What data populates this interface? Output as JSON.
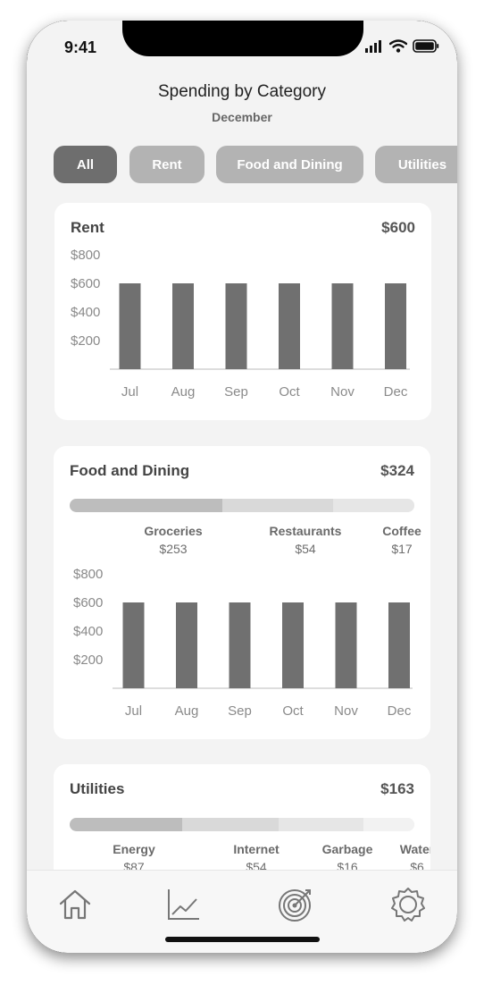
{
  "status": {
    "time": "9:41"
  },
  "header": {
    "title": "Spending by Category",
    "subtitle": "December"
  },
  "filters": [
    "All",
    "Rent",
    "Food and Dining",
    "Utilities"
  ],
  "cards": {
    "rent": {
      "title": "Rent",
      "amount": "$600"
    },
    "food": {
      "title": "Food and Dining",
      "amount": "$324",
      "breakdown": [
        {
          "name": "Groceries",
          "value": "$253"
        },
        {
          "name": "Restaurants",
          "value": "$54"
        },
        {
          "name": "Coffee",
          "value": "$17"
        }
      ]
    },
    "utilities": {
      "title": "Utilities",
      "amount": "$163",
      "breakdown": [
        {
          "name": "Energy",
          "value": "$87"
        },
        {
          "name": "Internet",
          "value": "$54"
        },
        {
          "name": "Garbage",
          "value": "$16"
        },
        {
          "name": "Water",
          "value": "$6"
        }
      ]
    }
  },
  "colors": {
    "bar": "#707070",
    "seg_dark": "#bdbdbd",
    "seg_mid": "#d9d9d9",
    "seg_light": "#e6e6e6",
    "chip": "#b3b3b3",
    "chip_active": "#6e6e6e"
  },
  "tabs": [
    "home-icon",
    "chart-icon",
    "target-icon",
    "gear-icon"
  ],
  "chart_data": [
    {
      "type": "bar",
      "categories": [
        "Jul",
        "Aug",
        "Sep",
        "Oct",
        "Nov",
        "Dec"
      ],
      "values": [
        600,
        600,
        600,
        600,
        600,
        600
      ],
      "yticks": [
        "$200",
        "$400",
        "$600",
        "$800"
      ],
      "ylim": [
        0,
        800
      ]
    },
    {
      "type": "bar",
      "categories": [
        "Jul",
        "Aug",
        "Sep",
        "Oct",
        "Nov",
        "Dec"
      ],
      "values": [
        600,
        600,
        600,
        600,
        600,
        600
      ],
      "yticks": [
        "$200",
        "$400",
        "$600",
        "$800"
      ],
      "ylim": [
        0,
        800
      ]
    }
  ]
}
